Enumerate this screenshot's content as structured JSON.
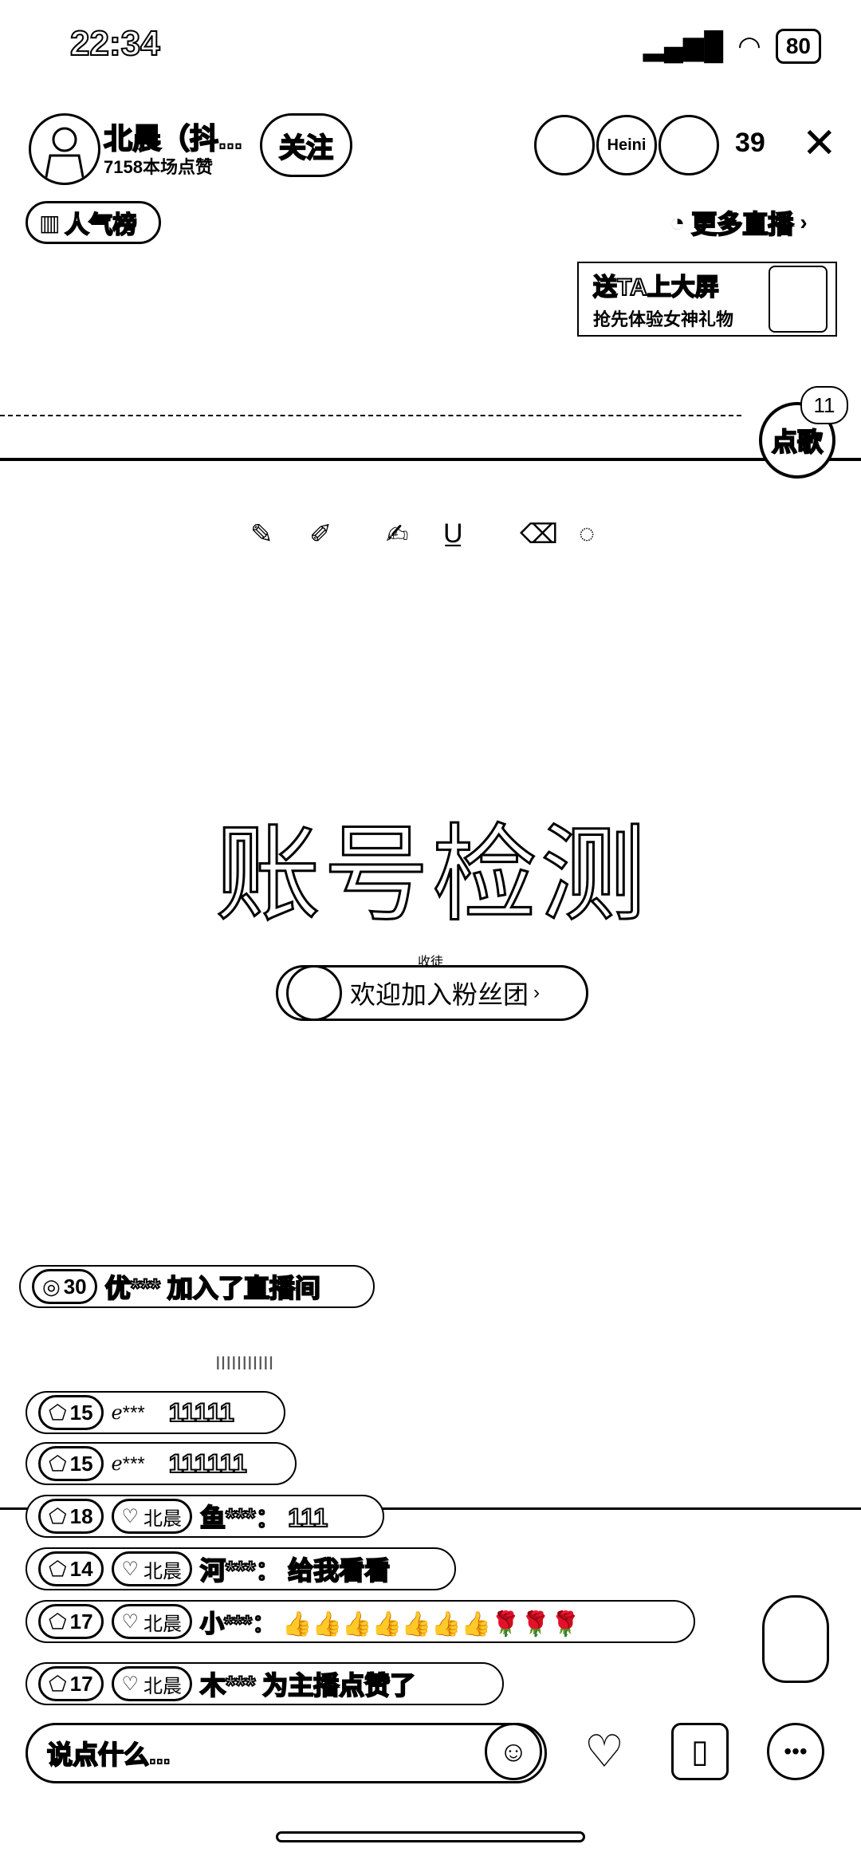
{
  "status_bar": {
    "time": "22:34",
    "battery": "80",
    "icons": [
      "signal-icon",
      "wifi-icon",
      "battery-icon"
    ]
  },
  "host": {
    "name": "北晨（抖...",
    "likes": "7158本场点赞",
    "follow_label": "关注"
  },
  "viewers": {
    "avatar_badge": "Heini",
    "count": "39"
  },
  "popularity_label": "人气榜",
  "more_live_label": "更多直播",
  "promo": {
    "line1": "送TA上大屏",
    "line2": "抢先体验女神礼物"
  },
  "song_request": {
    "label": "点歌",
    "badge": "11"
  },
  "stream": {
    "title": "账号检测",
    "small_label": "收徒",
    "fan_club_label": "欢迎加入粉丝团"
  },
  "chat": [
    {
      "level": "30",
      "fan": "",
      "text": "优*** 加入了直播间"
    },
    {
      "level": "",
      "fan": "",
      "text": "IIIIIIIIIII"
    },
    {
      "level": "15",
      "fan": "",
      "text": "11111"
    },
    {
      "level": "15",
      "fan": "",
      "text": "111111"
    },
    {
      "level": "18",
      "fan": "北晨",
      "text": "鱼***： 111"
    },
    {
      "level": "14",
      "fan": "北晨",
      "text": "河***： 给我看看"
    },
    {
      "level": "17",
      "fan": "北晨",
      "text": "小***： 👍👍👍👍👍👍👍🌹🌹🌹"
    },
    {
      "level": "17",
      "fan": "北晨",
      "text": "木*** 为主播点赞了"
    }
  ],
  "input": {
    "placeholder": "说点什么..."
  }
}
